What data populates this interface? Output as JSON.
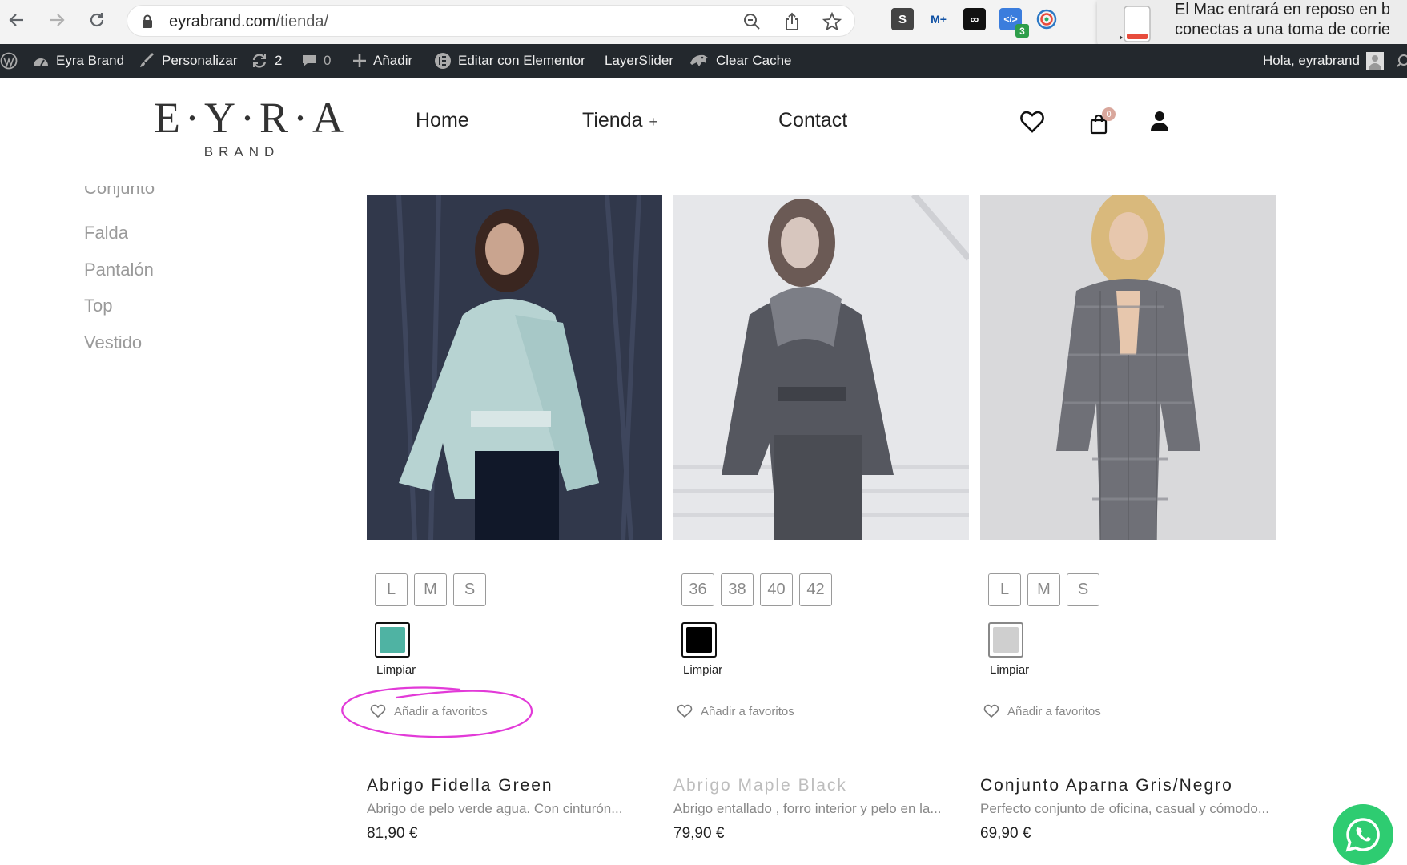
{
  "browser": {
    "url_domain": "eyrabrand.com",
    "url_path": "/tienda/",
    "extension_badge": "3"
  },
  "notification": {
    "line1": "El Mac entrará en reposo en b",
    "line2": "conectas a una toma de corrie"
  },
  "admin_bar": {
    "site_name": "Eyra Brand",
    "customize": "Personalizar",
    "updates_count": "2",
    "comments_count": "0",
    "add_new": "Añadir",
    "elementor": "Editar con Elementor",
    "layerslider": "LayerSlider",
    "clear_cache": "Clear Cache",
    "greeting": "Hola, eyrabrand"
  },
  "header": {
    "logo_main": "E·Y·R·A",
    "logo_sub": "BRAND",
    "nav": [
      "Home",
      "Tienda",
      "Contact"
    ],
    "nav_plus": "+",
    "cart_count": "0"
  },
  "sidebar": {
    "categories": [
      "Conjunto",
      "Falda",
      "Pantalón",
      "Top",
      "Vestido"
    ]
  },
  "products": [
    {
      "name": "Abrigo Fidella Green",
      "description": "Abrigo de pelo verde agua. Con cinturón...",
      "price": "81,90 €",
      "sizes": [
        "L",
        "M",
        "S"
      ],
      "color": "#4fb3a3",
      "clear_label": "Limpiar",
      "wishlist_label": "Añadir a favoritos"
    },
    {
      "name": "Abrigo Maple Black",
      "description": "Abrigo entallado , forro interior y pelo en la...",
      "price": "79,90 €",
      "sizes": [
        "36",
        "38",
        "40",
        "42"
      ],
      "color": "#000000",
      "clear_label": "Limpiar",
      "wishlist_label": "Añadir a favoritos"
    },
    {
      "name": "Conjunto Aparna Gris/Negro",
      "description": "Perfecto conjunto de oficina, casual y cómodo...",
      "price": "69,90 €",
      "sizes": [
        "L",
        "M",
        "S"
      ],
      "color": "#cfcfcf",
      "clear_label": "Limpiar",
      "wishlist_label": "Añadir a favoritos"
    }
  ]
}
